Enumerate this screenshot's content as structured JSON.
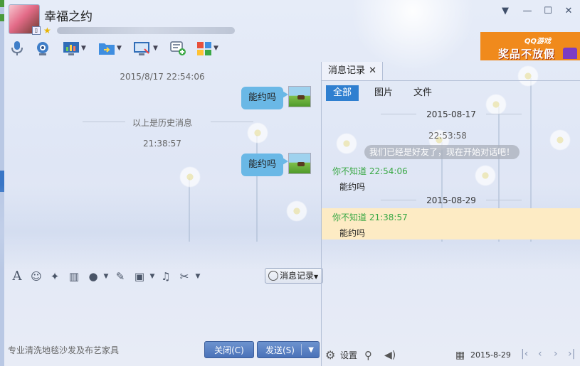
{
  "header": {
    "nickname": "幸福之约"
  },
  "ad": {
    "brand": "QQ游戏",
    "slogan": "奖品不放假"
  },
  "chat": {
    "messages": [
      {
        "timestamp": "2015/8/17 22:54:06",
        "text": "能约吗"
      },
      {
        "timestamp": "21:38:57",
        "text": "能约吗"
      }
    ],
    "history_divider": "以上是历史消息"
  },
  "input_toolbar": {
    "history_button": "消息记录"
  },
  "footer": {
    "ad_text": "专业清洗地毯沙发及布艺家具",
    "close_label": "关闭(C)",
    "send_label": "发送(S)"
  },
  "history_panel": {
    "tab_label": "消息记录",
    "filters": [
      "全部",
      "图片",
      "文件"
    ],
    "entries": [
      {
        "date": "2015-08-17",
        "time": "22:53:58",
        "system_msg": "我们已经是好友了，现在开始对话吧！",
        "sender_line": "你不知道 22:54:06",
        "text": "能约吗"
      },
      {
        "date": "2015-08-29",
        "sender_line": "你不知道 21:38:57",
        "text": "能约吗"
      }
    ],
    "settings_label": "设置",
    "date_display": "2015-8-29"
  },
  "colors": {
    "accent_blue": "#2f7fd0",
    "bubble_blue": "#6ab8e6",
    "sender_green": "#3aa845",
    "highlight": "#fdebc4",
    "ad_orange": "#f08a1c"
  }
}
